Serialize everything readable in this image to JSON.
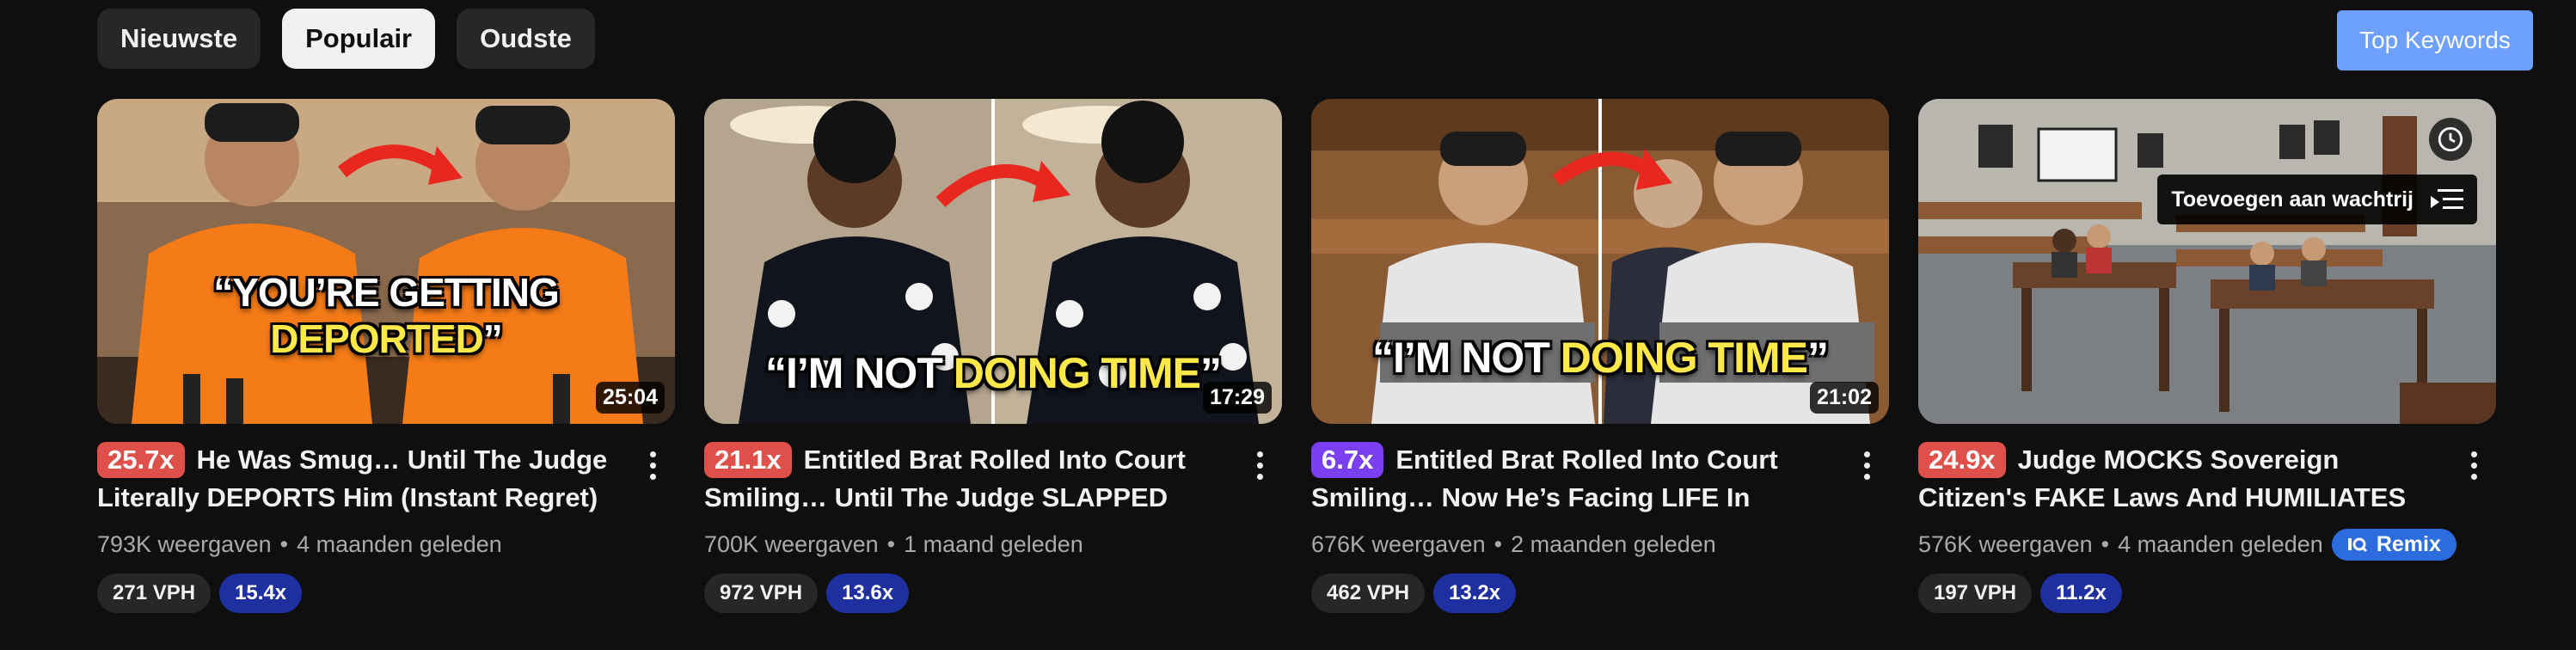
{
  "filters": [
    {
      "label": "Nieuwste",
      "active": false
    },
    {
      "label": "Populair",
      "active": true
    },
    {
      "label": "Oudste",
      "active": false
    }
  ],
  "top_keywords_label": "Top Keywords",
  "queue_tooltip": "Toevoegen aan wachtrij",
  "remix_label": "Remix",
  "colors": {
    "background": "#0f0f0f",
    "outlier_red": "#e0504a",
    "outlier_purple": "#7b3ff2",
    "multiplier_blue": "#1e2fa0",
    "top_keywords_blue": "#6ea0ff",
    "caption_highlight": "#ffe94a"
  },
  "videos": [
    {
      "caption_pre": "“YOU’RE GETTING ",
      "caption_hl": "DEPORTED",
      "caption_post": "”",
      "duration": "25:04",
      "outlier": "25.7x",
      "outlier_color": "#e0504a",
      "title": "He Was Smug… Until The Judge Literally DEPORTS Him (Instant Regret)",
      "views": "793K weergaven",
      "age": "4 maanden geleden",
      "vph": "271 VPH",
      "multiplier": "15.4x"
    },
    {
      "caption_pre": "“I’M NOT ",
      "caption_hl": "DOING TIME",
      "caption_post": "”",
      "duration": "17:29",
      "outlier": "21.1x",
      "outlier_color": "#e0504a",
      "title": "Entitled Brat Rolled Into Court Smiling… Until The Judge SLAPPED Him…",
      "views": "700K weergaven",
      "age": "1 maand geleden",
      "vph": "972 VPH",
      "multiplier": "13.6x"
    },
    {
      "caption_pre": "“I’M NOT ",
      "caption_hl": "DOING TIME",
      "caption_post": "”",
      "duration": "21:02",
      "outlier": "6.7x",
      "outlier_color": "#7b3ff2",
      "title": "Entitled Brat Rolled Into Court Smiling… Now He’s Facing LIFE In Prison…",
      "views": "676K weergaven",
      "age": "2 maanden geleden",
      "vph": "462 VPH",
      "multiplier": "13.2x"
    },
    {
      "caption_pre": "",
      "caption_hl": "",
      "caption_post": "",
      "duration": "",
      "outlier": "24.9x",
      "outlier_color": "#e0504a",
      "title": "Judge MOCKS Sovereign Citizen's FAKE Laws And HUMILIATES Him Into…",
      "views": "576K weergaven",
      "age": "4 maanden geleden",
      "vph": "197 VPH",
      "multiplier": "11.2x"
    }
  ]
}
